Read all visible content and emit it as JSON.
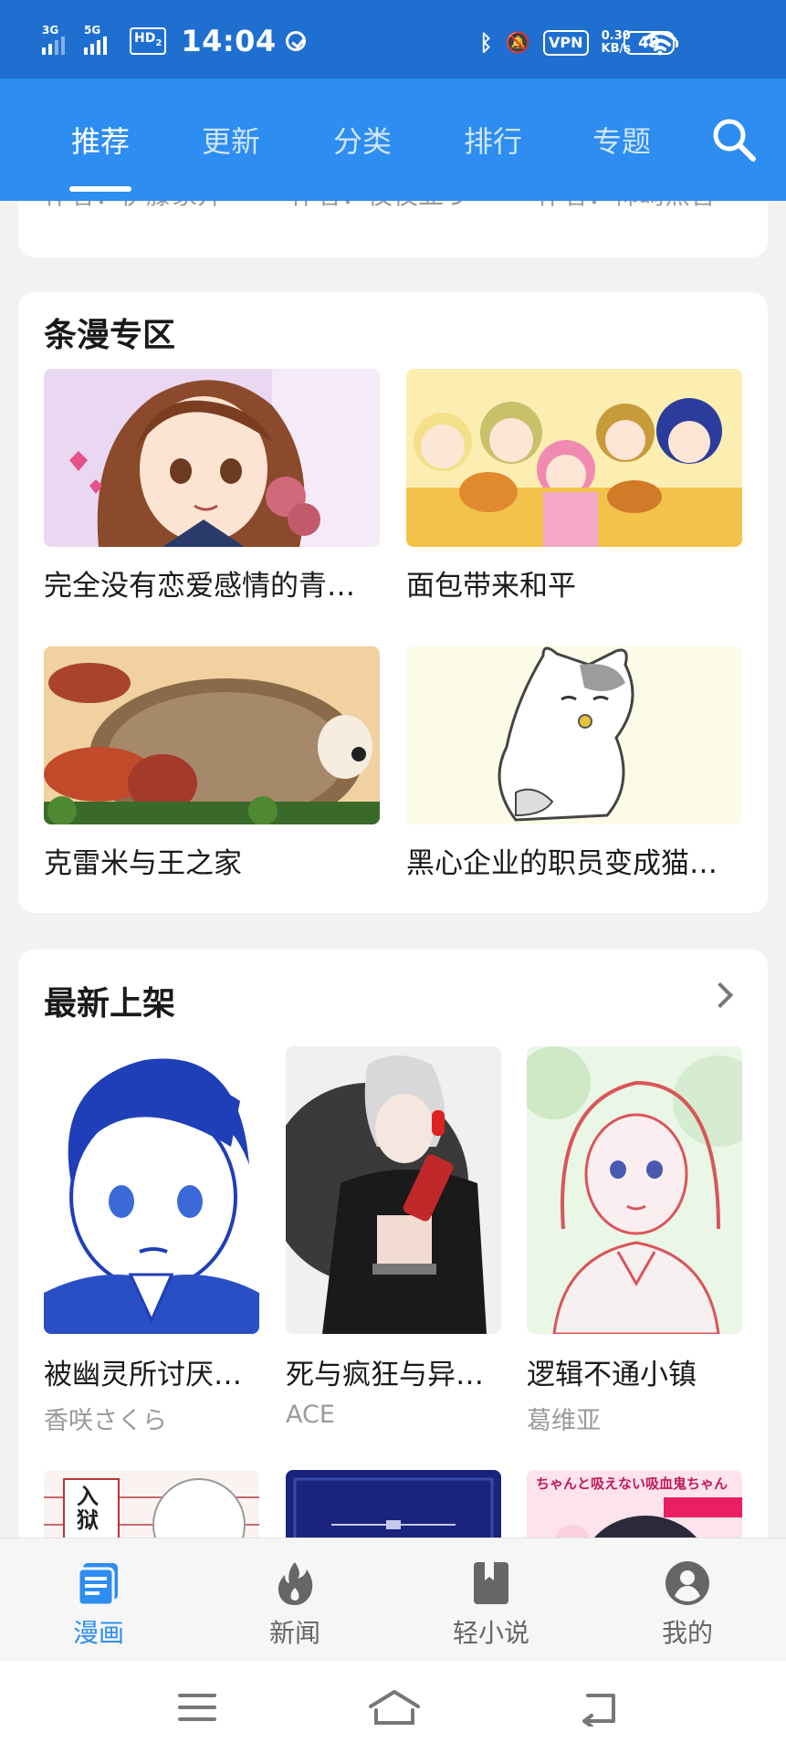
{
  "status_bar": {
    "net_1": "3G",
    "net_2": "5G",
    "hd": "HD",
    "hd_sub": "2",
    "time": "14:04",
    "vpn": "VPN",
    "speed_value": "0.30",
    "speed_unit": "KB/s",
    "battery": "49"
  },
  "top_tabs": [
    "推荐",
    "更新",
    "分类",
    "排行",
    "专题"
  ],
  "prev_card": {
    "authors": [
      "作者：伊藤家开",
      "作者：夜夜亚う",
      "作者：柿崎黑音"
    ]
  },
  "webtoon_section": {
    "title": "条漫专区",
    "items": [
      {
        "title": "完全没有恋爱感情的青…"
      },
      {
        "title": "面包带来和平"
      },
      {
        "title": "克雷米与王之家"
      },
      {
        "title": "黑心企业的职员变成猫…"
      }
    ]
  },
  "new_section": {
    "title": "最新上架",
    "items": [
      {
        "title": "被幽灵所讨厌…",
        "author": "香咲さくら"
      },
      {
        "title": "死与疯狂与异…",
        "author": "ACE"
      },
      {
        "title": "逻辑不通小镇",
        "author": "葛维亚"
      }
    ],
    "partial_cover_texts": [
      "入狱",
      "ちゃんと吸えない吸血鬼ちゃん"
    ]
  },
  "bottom_nav": [
    "漫画",
    "新闻",
    "轻小说",
    "我的"
  ],
  "colors": {
    "status_bar": "#1f6fd1",
    "tab_bar": "#2d8df0",
    "active_accent": "#2d8df0"
  }
}
